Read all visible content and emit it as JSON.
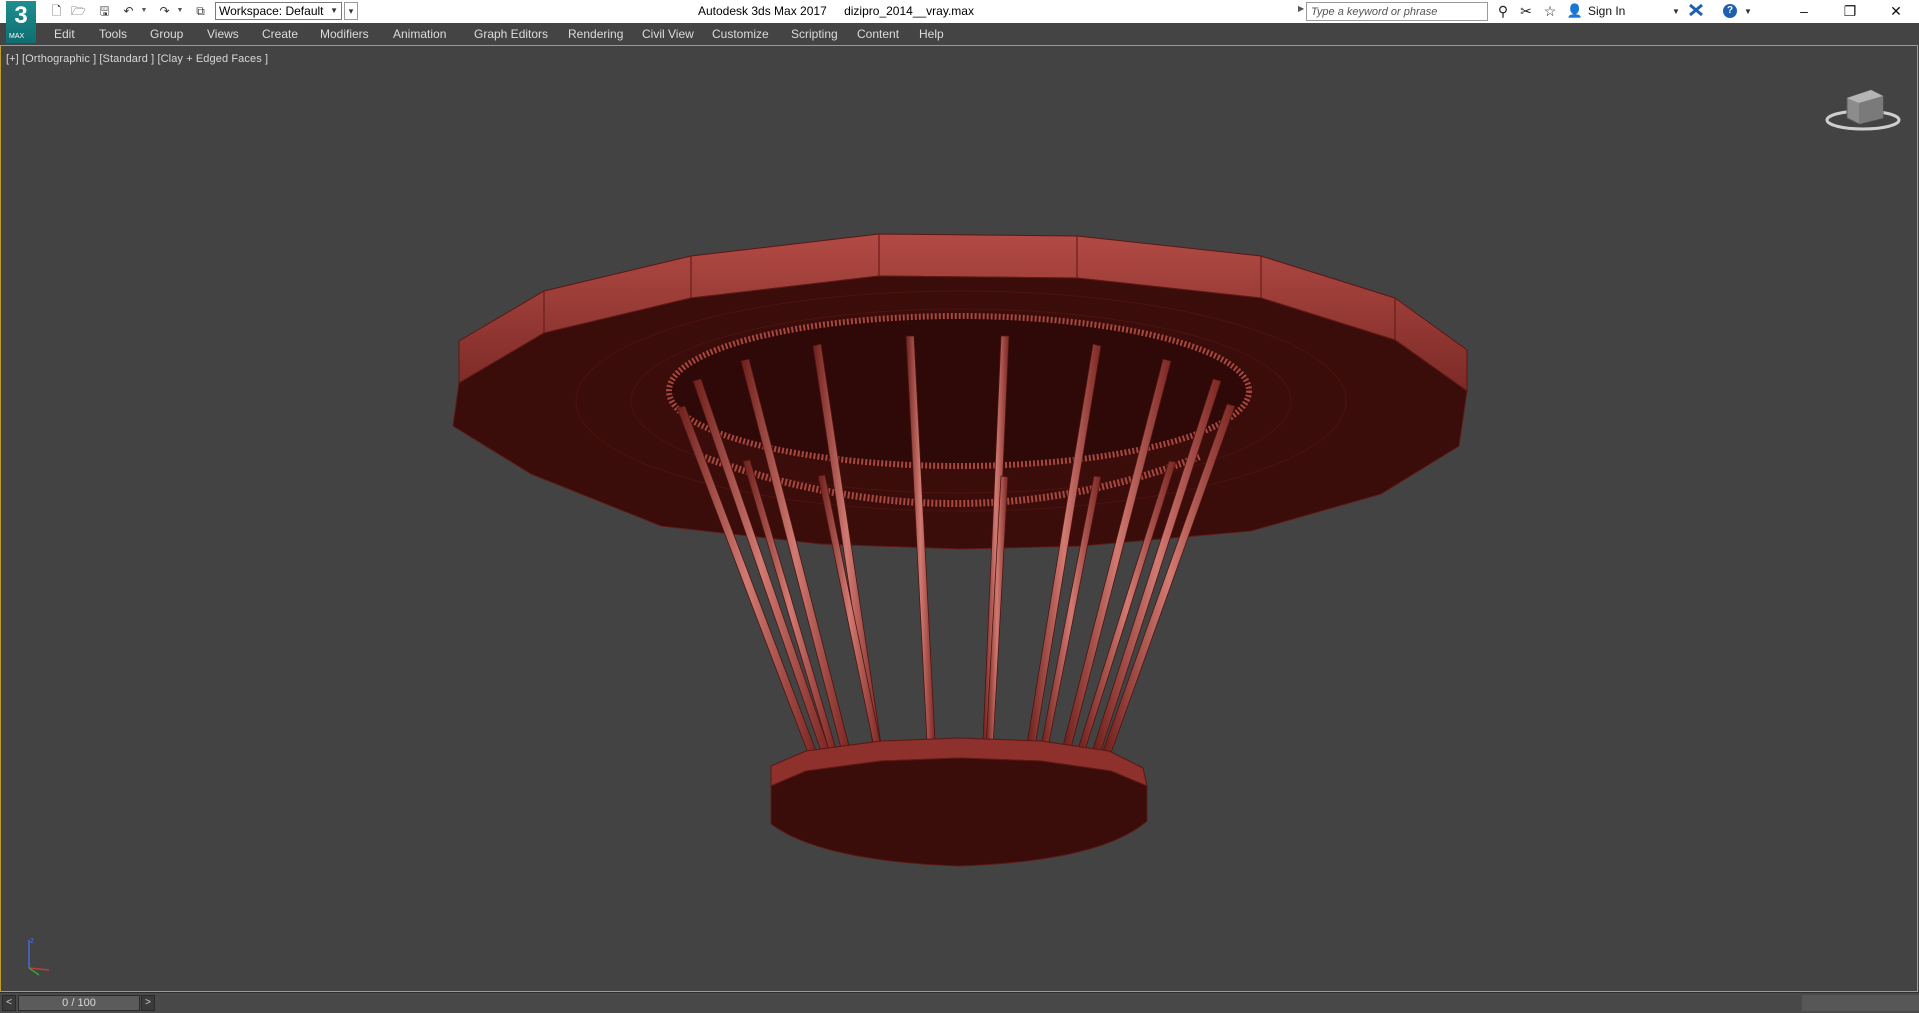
{
  "titlebar": {
    "app_logo_glyph": "3",
    "app_logo_caption": "MAX",
    "quick_access": [
      {
        "name": "new-file-icon",
        "glyph": "🗋"
      },
      {
        "name": "open-file-icon",
        "glyph": "🗁"
      },
      {
        "name": "save-file-icon",
        "glyph": "🖫"
      },
      {
        "name": "undo-icon",
        "glyph": "↶"
      },
      {
        "name": "redo-icon",
        "glyph": "↷"
      },
      {
        "name": "project-folder-icon",
        "glyph": "⧉"
      }
    ],
    "workspace_label": "Workspace: Default",
    "app_name": "Autodesk 3ds Max 2017",
    "file_name": "dizipro_2014__vray.max",
    "search_placeholder": "Type a keyword or phrase",
    "search_icons": [
      {
        "name": "binoculars-icon",
        "glyph": "⚲"
      },
      {
        "name": "tools-icon",
        "glyph": "✂"
      },
      {
        "name": "favorites-star-icon",
        "glyph": "☆"
      }
    ],
    "sign_in_label": "Sign In",
    "exchange_icon": "exchange-icon",
    "help_glyph": "?",
    "window_buttons": {
      "minimize": "–",
      "restore": "❐",
      "close": "✕"
    }
  },
  "menubar": {
    "items": [
      "Edit",
      "Tools",
      "Group",
      "Views",
      "Create",
      "Modifiers",
      "Animation",
      "Graph Editors",
      "Rendering",
      "Civil View",
      "Customize",
      "Scripting",
      "Content",
      "Help"
    ]
  },
  "viewport": {
    "label": "[+] [Orthographic ] [Standard ] [Clay + Edged Faces ]",
    "model_color": "#a8413c",
    "background_color": "#434343",
    "active_border_color": "#c39a2e"
  },
  "timeslider": {
    "frame_readout": "0 / 100",
    "current_frame": 0,
    "total_frames": 100,
    "prev_glyph": "<",
    "next_glyph": ">"
  }
}
